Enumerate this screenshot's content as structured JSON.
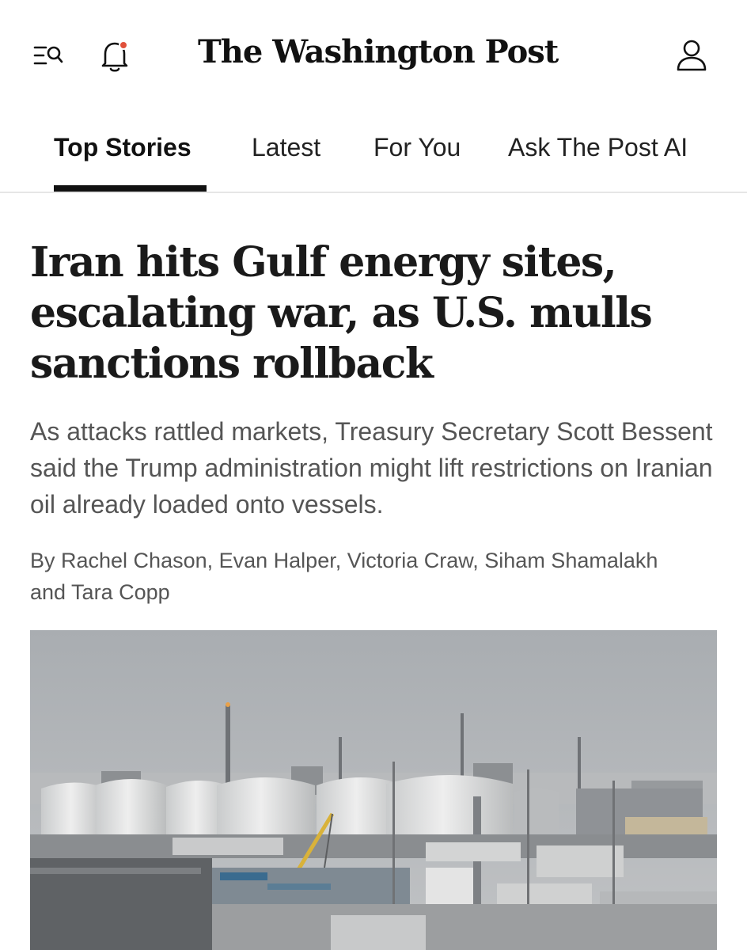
{
  "header": {
    "logo_text": "The Washington Post",
    "icons": {
      "menu_search": "menu-search-icon",
      "notifications": "bell-icon",
      "notification_dot_color": "#e0503a",
      "profile": "user-icon"
    }
  },
  "tabs": [
    {
      "label": "Top Stories",
      "active": true
    },
    {
      "label": "Latest",
      "active": false
    },
    {
      "label": "For You",
      "active": false
    },
    {
      "label": "Ask The Post AI",
      "active": false
    }
  ],
  "article": {
    "headline": "Iran hits Gulf energy sites, escalating war, as U.S. mulls sanctions rollback",
    "dek": "As attacks rattled markets, Treasury Secretary Scott Bessent said the Trump administration might lift restrictions on Iranian oil already loaded onto vessels.",
    "byline": "By Rachel Chason, Evan Halper, Victoria Craw, Siham Shamalakh and Tara Copp",
    "image": "industrial-gas-facility-storage-tanks-photo"
  },
  "colors": {
    "text": "#111111",
    "secondary_text": "#555555",
    "divider": "#e6e6e6"
  }
}
